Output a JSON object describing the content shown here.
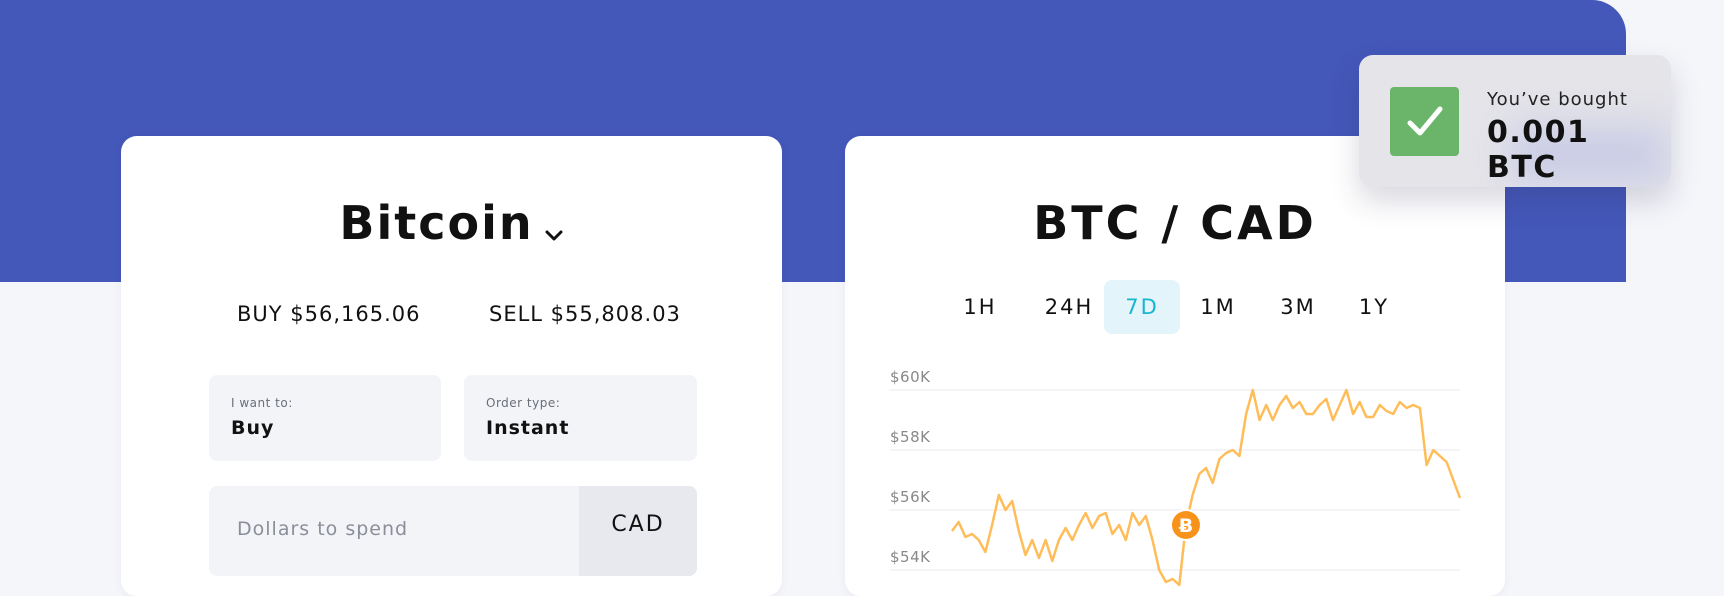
{
  "buy_panel": {
    "coin": "Bitcoin",
    "buy_price": "BUY $56,165.06",
    "sell_price": "SELL $55,808.03",
    "want_label": "I want to:",
    "want_value": "Buy",
    "order_label": "Order type:",
    "order_value": "Instant",
    "spend_placeholder": "Dollars to spend",
    "currency": "CAD"
  },
  "chart_panel": {
    "pair": "BTC / CAD",
    "tabs": [
      "1H",
      "24H",
      "7D",
      "1M",
      "3M",
      "1Y"
    ],
    "active_tab": "7D"
  },
  "toast": {
    "line1": "You’ve bought",
    "line2": "0.001 BTC"
  },
  "colors": {
    "brand": "#4458b9",
    "accent": "#18b5d1",
    "line": "#ffbd59",
    "success": "#6bb56a",
    "marker": "#f7931a"
  },
  "chart_data": {
    "type": "line",
    "y_ticks": [
      "$60K",
      "$58K",
      "$56K",
      "$54K"
    ],
    "ylim": [
      53.5,
      60.5
    ],
    "y_unit": "thousand CAD",
    "marker_index": 35,
    "marker_icon": "bitcoin-icon",
    "series": [
      {
        "values": [
          55.3,
          55.6,
          55.1,
          55.2,
          55.0,
          54.6,
          55.5,
          56.5,
          56.0,
          56.3,
          55.3,
          54.5,
          55.0,
          54.4,
          55.0,
          54.3,
          55.0,
          55.4,
          55.0,
          55.5,
          55.9,
          55.4,
          55.8,
          55.9,
          55.2,
          55.5,
          55.0,
          55.9,
          55.5,
          55.8,
          55.0,
          54.0,
          53.6,
          53.7,
          53.5,
          55.5,
          56.5,
          57.2,
          57.4,
          56.9,
          57.7,
          57.9,
          58.0,
          57.8,
          59.2,
          60.0,
          59.0,
          59.5,
          59.0,
          59.5,
          59.8,
          59.4,
          59.6,
          59.2,
          59.2,
          59.5,
          59.7,
          59.0,
          59.5,
          60.0,
          59.2,
          59.6,
          59.1,
          59.1,
          59.5,
          59.3,
          59.2,
          59.6,
          59.4,
          59.5,
          59.4,
          57.5,
          58.0,
          57.8,
          57.6,
          57.0,
          56.4
        ]
      }
    ]
  }
}
